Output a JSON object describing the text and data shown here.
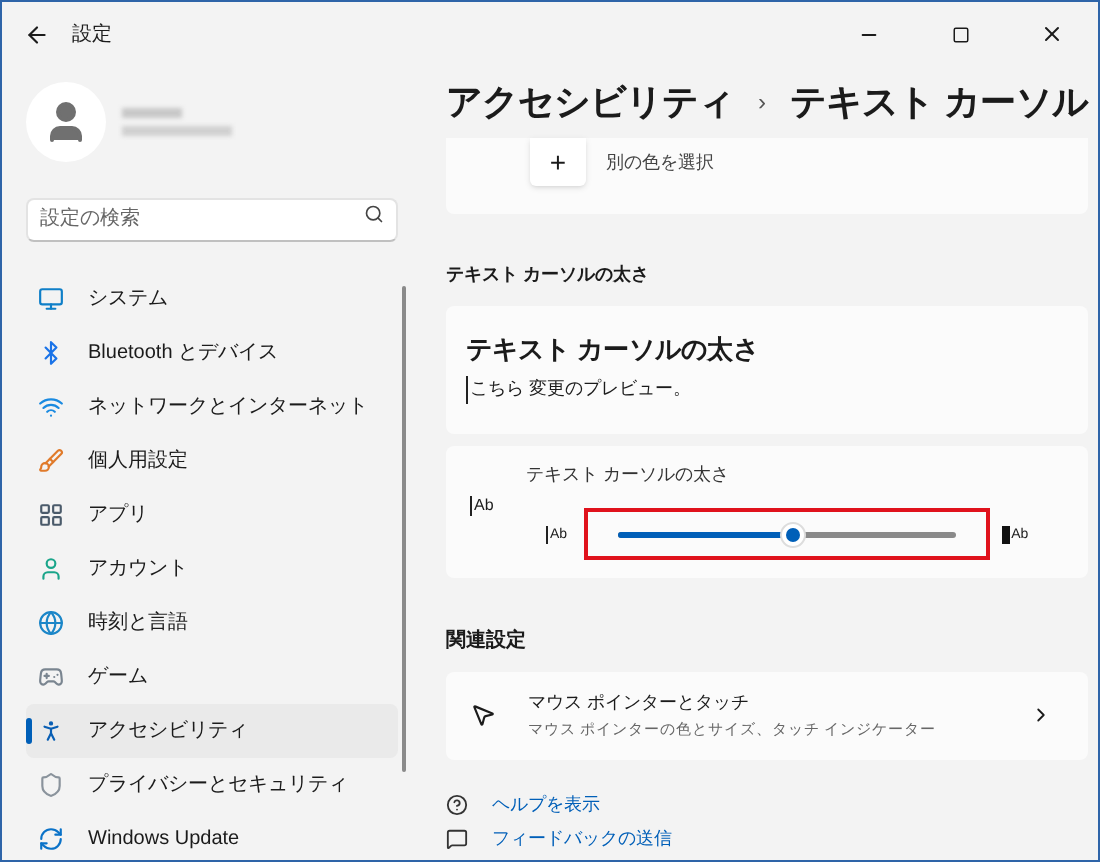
{
  "window": {
    "title": "設定"
  },
  "search": {
    "placeholder": "設定の検索"
  },
  "sidebar": {
    "items": [
      {
        "label": "システム",
        "selected": false
      },
      {
        "label": "Bluetooth とデバイス",
        "selected": false
      },
      {
        "label": "ネットワークとインターネット",
        "selected": false
      },
      {
        "label": "個人用設定",
        "selected": false
      },
      {
        "label": "アプリ",
        "selected": false
      },
      {
        "label": "アカウント",
        "selected": false
      },
      {
        "label": "時刻と言語",
        "selected": false
      },
      {
        "label": "ゲーム",
        "selected": false
      },
      {
        "label": "アクセシビリティ",
        "selected": true
      },
      {
        "label": "プライバシーとセキュリティ",
        "selected": false
      },
      {
        "label": "Windows Update",
        "selected": false
      }
    ]
  },
  "breadcrumb": {
    "parent": "アクセシビリティ",
    "separator": "›",
    "current": "テキスト カーソル"
  },
  "color_card": {
    "button": "+",
    "label": "別の色を選択"
  },
  "thickness_section": {
    "heading": "テキスト カーソルの太さ",
    "preview": {
      "title": "テキスト カーソルの太さ",
      "text": "こちら 変更のプレビュー。"
    },
    "slider": {
      "label": "テキスト カーソルの太さ",
      "sample_large": "Ab",
      "sample_min": "Ab",
      "sample_max": "Ab",
      "level": 0.52,
      "highlighted": true
    }
  },
  "related": {
    "heading": "関連設定",
    "items": [
      {
        "title": "マウス ポインターとタッチ",
        "subtitle": "マウス ポインターの色とサイズ、タッチ インジケーター"
      }
    ]
  },
  "links": [
    "ヘルプを表示",
    "フィードバックの送信"
  ]
}
